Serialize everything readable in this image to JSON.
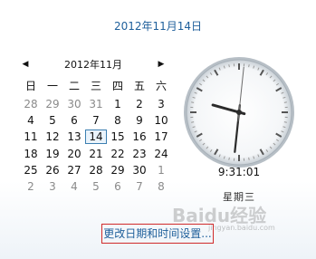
{
  "header": {
    "date": "2012年11月14日"
  },
  "calendar": {
    "month_title": "2012年11月",
    "weekdays": [
      "日",
      "一",
      "二",
      "三",
      "四",
      "五",
      "六"
    ],
    "weeks": [
      [
        "28",
        "29",
        "30",
        "31",
        "1",
        "2",
        "3"
      ],
      [
        "4",
        "5",
        "6",
        "7",
        "8",
        "9",
        "10"
      ],
      [
        "11",
        "12",
        "13",
        "14",
        "15",
        "16",
        "17"
      ],
      [
        "18",
        "19",
        "20",
        "21",
        "22",
        "23",
        "24"
      ],
      [
        "25",
        "26",
        "27",
        "28",
        "29",
        "30",
        "1"
      ],
      [
        "2",
        "3",
        "4",
        "5",
        "6",
        "7",
        "8"
      ]
    ],
    "muted": [
      [
        true,
        true,
        true,
        true,
        false,
        false,
        false
      ],
      [
        false,
        false,
        false,
        false,
        false,
        false,
        false
      ],
      [
        false,
        false,
        false,
        false,
        false,
        false,
        false
      ],
      [
        false,
        false,
        false,
        false,
        false,
        false,
        false
      ],
      [
        false,
        false,
        false,
        false,
        false,
        false,
        true
      ],
      [
        true,
        true,
        true,
        true,
        true,
        true,
        true
      ]
    ],
    "selected_day": "14"
  },
  "clock": {
    "time": "9:31:01",
    "weekday": "星期三",
    "hours": 9,
    "minutes": 31,
    "seconds": 1
  },
  "link": {
    "label": "更改日期和时间设置..."
  },
  "watermark": {
    "main": "Baidu经验",
    "sub": "jingyan.baidu.com"
  },
  "colors": {
    "accent": "#1e5f9b",
    "highlight_border": "#d02b2b"
  }
}
